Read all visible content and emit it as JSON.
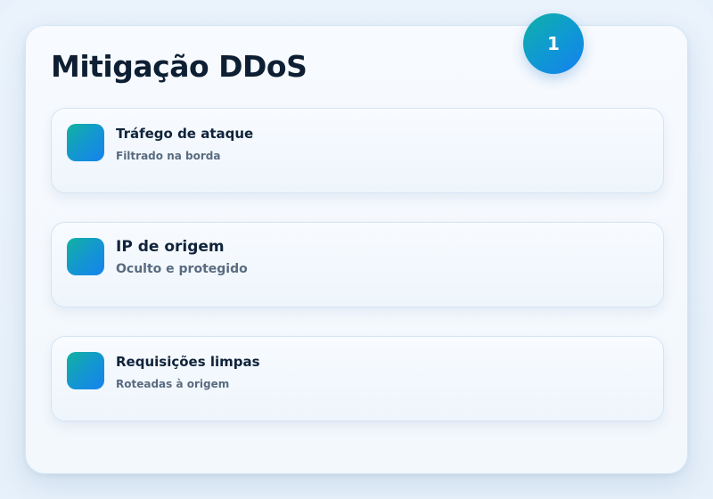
{
  "header": {
    "title": "Mitigação DDoS",
    "step_badge": "1"
  },
  "features": [
    {
      "icon": "gradient-square-icon",
      "title": "Tráfego de ataque",
      "subtitle": "Filtrado na borda"
    },
    {
      "icon": "gradient-square-icon",
      "title": "IP de origem",
      "subtitle": "Oculto e protegido"
    },
    {
      "icon": "gradient-square-icon",
      "title": "Requisições limpas",
      "subtitle": "Roteadas à origem"
    }
  ],
  "colors": {
    "accent_start": "#10b3a0",
    "accent_end": "#1583ee",
    "title_text": "#0e1f33",
    "subtitle_text": "#5a6b80",
    "background": "#e7f1fb"
  }
}
